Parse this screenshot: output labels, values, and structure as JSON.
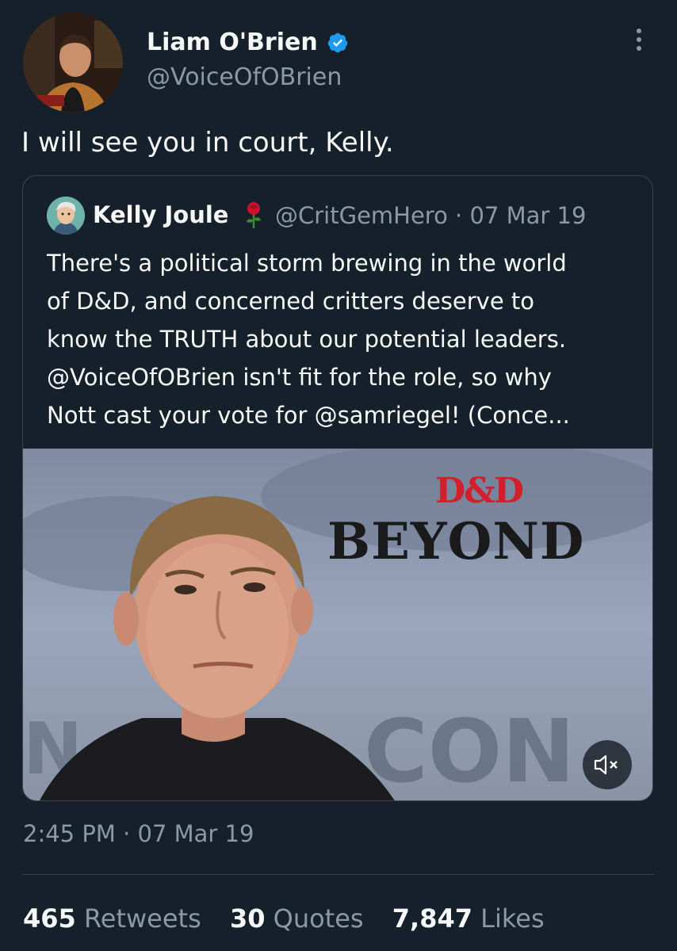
{
  "author": {
    "name": "Liam O'Brien",
    "handle": "@VoiceOfOBrien",
    "verified_icon": "verified-badge-icon"
  },
  "tweet": {
    "text": "I will see you in court, Kelly."
  },
  "quoted": {
    "name": "Kelly Joule",
    "emoji": "rose",
    "handle_date": "@CritGemHero · 07 Mar 19",
    "lines": [
      "There's a political storm brewing in the world",
      "of D&D, and concerned critters deserve to",
      "know the TRUTH about our potential leaders.",
      "@VoiceOfOBrien isn't fit for the role, so why",
      "Nott cast your vote for @samriegel! (Conce..."
    ],
    "media": {
      "logo_top": "D&D",
      "logo_bottom": "BEYOND",
      "mute_icon": "muted-speaker-icon"
    }
  },
  "timestamp": "2:45 PM · 07 Mar 19",
  "stats": {
    "retweets_count": "465",
    "retweets_label": "Retweets",
    "quotes_count": "30",
    "quotes_label": "Quotes",
    "likes_count": "7,847",
    "likes_label": "Likes"
  },
  "colors": {
    "background": "#15202b",
    "text": "#f7f9f9",
    "secondary": "#8b98a5",
    "verified": "#1d9bf0",
    "border": "#38444d"
  }
}
